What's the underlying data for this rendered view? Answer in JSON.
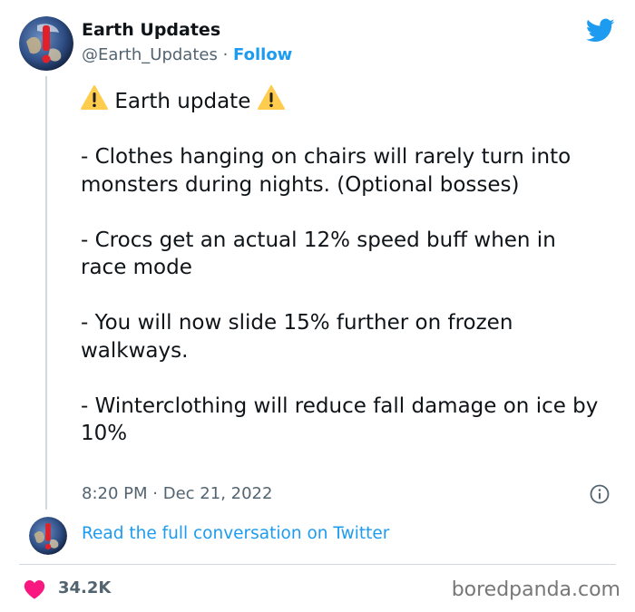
{
  "account": {
    "name": "Earth Updates",
    "handle": "@Earth_Updates",
    "separator": "·",
    "follow_label": "Follow"
  },
  "tweet": {
    "title": "Earth update",
    "paragraphs": [
      "- Clothes hanging on chairs will rarely turn into monsters during nights. (Optional bosses)",
      "- Crocs get an actual 12% speed buff when in race mode",
      "- You will now slide 15% further on frozen walkways.",
      "- Winterclothing will reduce fall damage on ice by 10%"
    ],
    "time": "8:20 PM",
    "date_separator": "·",
    "date": "Dec 21, 2022"
  },
  "conversation_link": "Read the full conversation on Twitter",
  "likes": "34.2K",
  "watermark": "boredpanda.com",
  "icons": {
    "brand": "twitter-bird-icon",
    "warning": "warning-icon",
    "info": "info-icon",
    "like": "heart-icon"
  },
  "colors": {
    "link": "#1d9bf0",
    "secondary_text": "#536471",
    "heart": "#f91880",
    "warning": "#ffcc4d"
  }
}
